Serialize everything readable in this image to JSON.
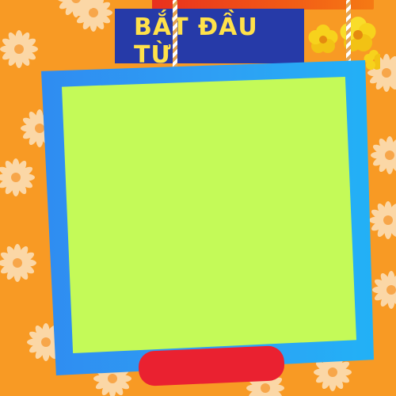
{
  "title": {
    "text": "BẮT ĐẦU TỪ"
  },
  "colors": {
    "background": "#f89a24",
    "title_board": "#263aa8",
    "title_text": "#ffe14a",
    "frame": "#2ea0f4",
    "panel": "#c4fa58",
    "button": "#ea2130"
  },
  "icons": {
    "background_pattern": "daisy-flower-icon",
    "corner_decoration": "apricot-blossom-icon"
  }
}
